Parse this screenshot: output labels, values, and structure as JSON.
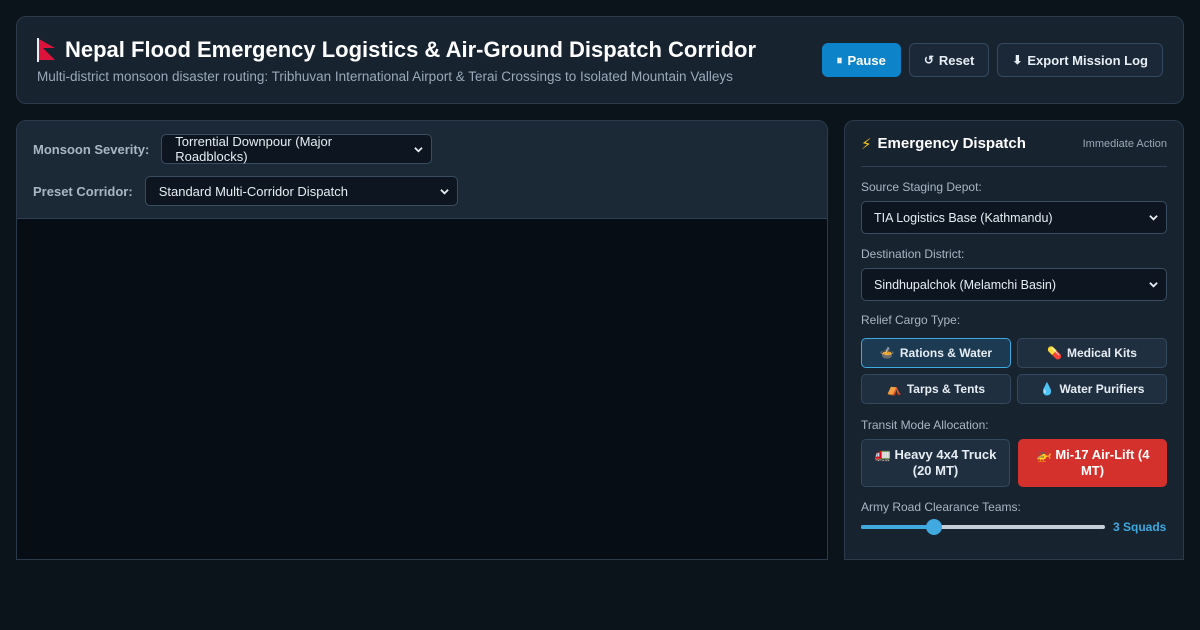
{
  "header": {
    "title": "Nepal Flood Emergency Logistics & Air-Ground Dispatch Corridor",
    "subtitle": "Multi-district monsoon disaster routing: Tribhuvan International Airport & Terai Crossings to Isolated Mountain Valleys",
    "buttons": {
      "pause": {
        "icon": "⏸",
        "label": "Pause"
      },
      "reset": {
        "icon": "↺",
        "label": "Reset"
      },
      "export": {
        "icon": "⬇",
        "label": "Export Mission Log"
      }
    },
    "flag_icon": "nepal-flag-icon"
  },
  "controls": {
    "severity": {
      "label": "Monsoon Severity:",
      "value": "Torrential Downpour (Major Roadblocks)"
    },
    "corridor": {
      "label": "Preset Corridor:",
      "value": "Standard Multi-Corridor Dispatch"
    }
  },
  "dispatch": {
    "title_icon": "⚡",
    "title": "Emergency Dispatch",
    "badge": "Immediate Action",
    "source": {
      "label": "Source Staging Depot:",
      "value": "TIA Logistics Base (Kathmandu)"
    },
    "destination": {
      "label": "Destination District:",
      "value": "Sindhupalchok (Melamchi Basin)"
    },
    "cargo": {
      "label": "Relief Cargo Type:",
      "items": [
        {
          "icon": "🍲",
          "label": "Rations & Water",
          "active": true
        },
        {
          "icon": "💊",
          "label": "Medical Kits",
          "active": false
        },
        {
          "icon": "⛺",
          "label": "Tarps & Tents",
          "active": false
        },
        {
          "icon": "💧",
          "label": "Water Purifiers",
          "active": false
        }
      ]
    },
    "transit": {
      "label": "Transit Mode Allocation:",
      "truck": {
        "icon": "🚛",
        "label": "Heavy 4x4 Truck (20 MT)"
      },
      "air": {
        "icon": "🚁",
        "label": "Mi-17 Air-Lift (4 MT)"
      }
    },
    "teams": {
      "label": "Army Road Clearance Teams:",
      "value_text": "3 Squads",
      "fraction": 0.3
    }
  },
  "colors": {
    "accent": "#3fa9e0",
    "primary": "#0d84c9",
    "danger": "#d4312c",
    "flag": "#dc143c"
  }
}
